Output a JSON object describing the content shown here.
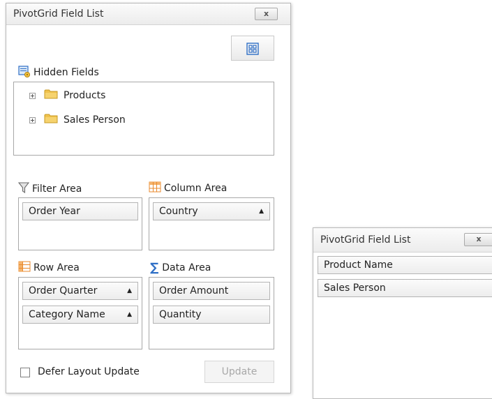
{
  "main_window": {
    "title": "PivotGrid Field List",
    "close_label": "x",
    "hidden_fields": {
      "label": "Hidden Fields",
      "items": [
        {
          "label": "Products"
        },
        {
          "label": "Sales Person"
        }
      ]
    },
    "filter_area": {
      "label": "Filter Area",
      "fields": [
        "Order Year"
      ]
    },
    "column_area": {
      "label": "Column Area",
      "fields": [
        "Country"
      ]
    },
    "row_area": {
      "label": "Row Area",
      "fields": [
        "Order Quarter",
        "Category Name"
      ]
    },
    "data_area": {
      "label": "Data Area",
      "fields": [
        "Order Amount",
        "Quantity"
      ]
    },
    "defer_layout_update": {
      "label": "Defer Layout Update",
      "checked": false
    },
    "update_button": {
      "label": "Update",
      "enabled": false
    },
    "sort_arrow_glyph": "▲",
    "icons": [
      "layout-toggle-icon",
      "hidden-fields-icon",
      "folder-icon",
      "expand-icon",
      "filter-funnel-icon",
      "column-grid-icon",
      "row-grid-icon",
      "sigma-icon"
    ]
  },
  "compact_window": {
    "title": "PivotGrid Field List",
    "close_label": "x",
    "fields": [
      "Product Name",
      "Sales Person"
    ]
  },
  "colors": {
    "window_border": "#b9b9b9",
    "title_bar": "#ececec",
    "field_background": "#ededed",
    "folder": "#f0c24d",
    "icon_blue": "#2f6fc6",
    "icon_orange": "#e8892c",
    "disabled_text": "#a8a8a8"
  }
}
